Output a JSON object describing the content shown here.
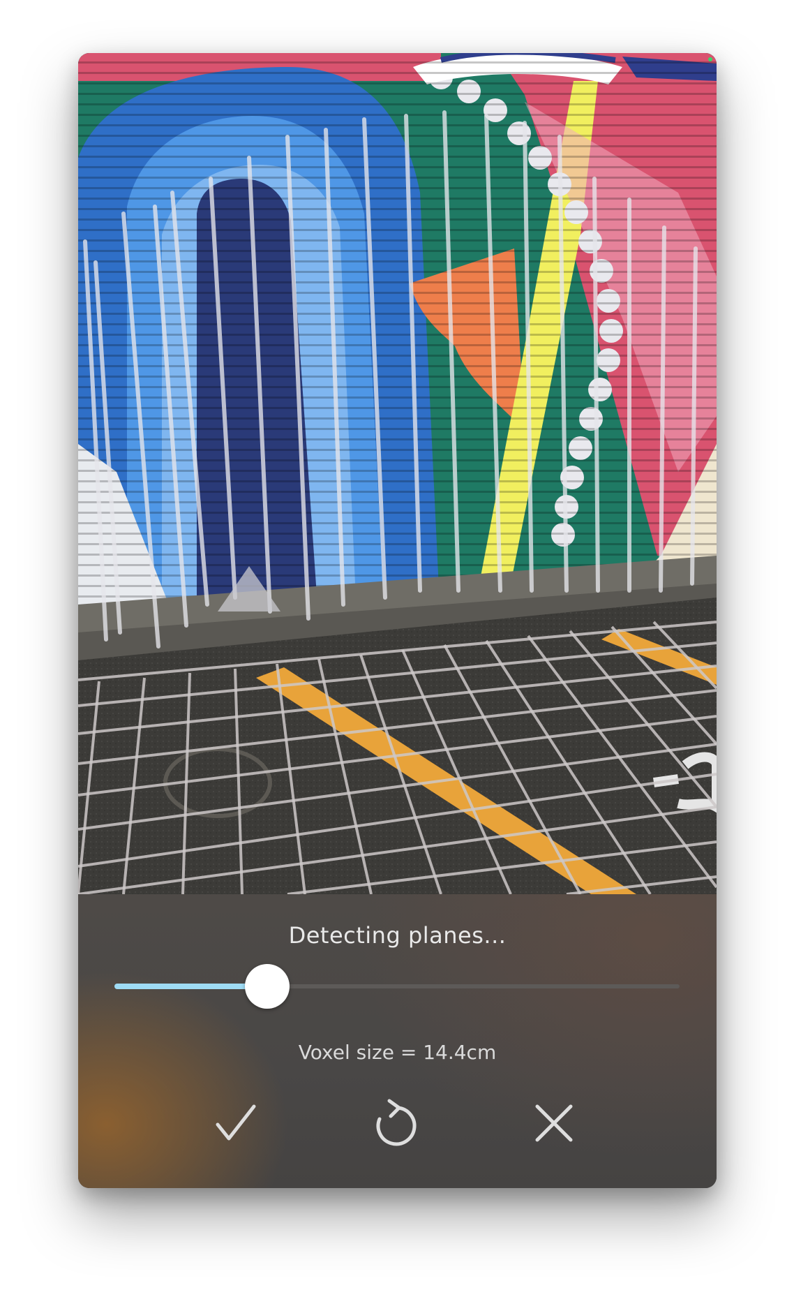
{
  "status_text": "Detecting planes...",
  "slider": {
    "value_fraction": 0.27
  },
  "voxel_label": "Voxel size = 14.4cm",
  "actions": [
    {
      "name": "confirm-button",
      "icon": "checkmark-icon"
    },
    {
      "name": "reset-button",
      "icon": "refresh-icon"
    },
    {
      "name": "cancel-button",
      "icon": "close-icon"
    }
  ],
  "colors": {
    "slider_fill": "#9fdcf5",
    "slider_track": "#5d5a58",
    "panel_bg": "#4b4846",
    "icon": "#dedede"
  }
}
